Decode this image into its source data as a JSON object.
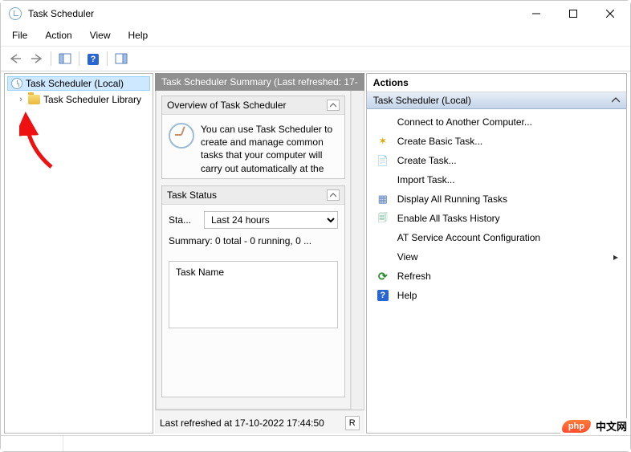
{
  "window": {
    "title": "Task Scheduler"
  },
  "menubar": [
    "File",
    "Action",
    "View",
    "Help"
  ],
  "tree": {
    "root_label": "Task Scheduler (Local)",
    "child_label": "Task Scheduler Library"
  },
  "center": {
    "header": "Task Scheduler Summary (Last refreshed: 17-",
    "overview_title": "Overview of Task Scheduler",
    "overview_text": "You can use Task Scheduler to create and manage common tasks that your computer will carry out automatically at the",
    "status_title": "Task Status",
    "status_label": "Sta...",
    "status_period_selected": "Last 24 hours",
    "summary_line": "Summary: 0 total - 0 running, 0 ...",
    "taskname_label": "Task Name",
    "footer_text": "Last refreshed at 17-10-2022 17:44:50",
    "refresh_btn": "R"
  },
  "actions": {
    "pane_title": "Actions",
    "group_title": "Task Scheduler (Local)",
    "items": [
      {
        "icon": "",
        "label": "Connect to Another Computer..."
      },
      {
        "icon": "ic-yellow-star",
        "label": "Create Basic Task..."
      },
      {
        "icon": "ic-page",
        "label": "Create Task..."
      },
      {
        "icon": "",
        "label": "Import Task..."
      },
      {
        "icon": "ic-grid",
        "label": "Display All Running Tasks"
      },
      {
        "icon": "ic-history",
        "label": "Enable All Tasks History"
      },
      {
        "icon": "",
        "label": "AT Service Account Configuration"
      },
      {
        "icon": "",
        "label": "View",
        "has_submenu": true
      },
      {
        "icon": "ic-refresh",
        "label": "Refresh"
      },
      {
        "icon": "ic-help",
        "label": "Help"
      }
    ]
  },
  "watermark": {
    "badge": "php",
    "text": "中文网"
  }
}
